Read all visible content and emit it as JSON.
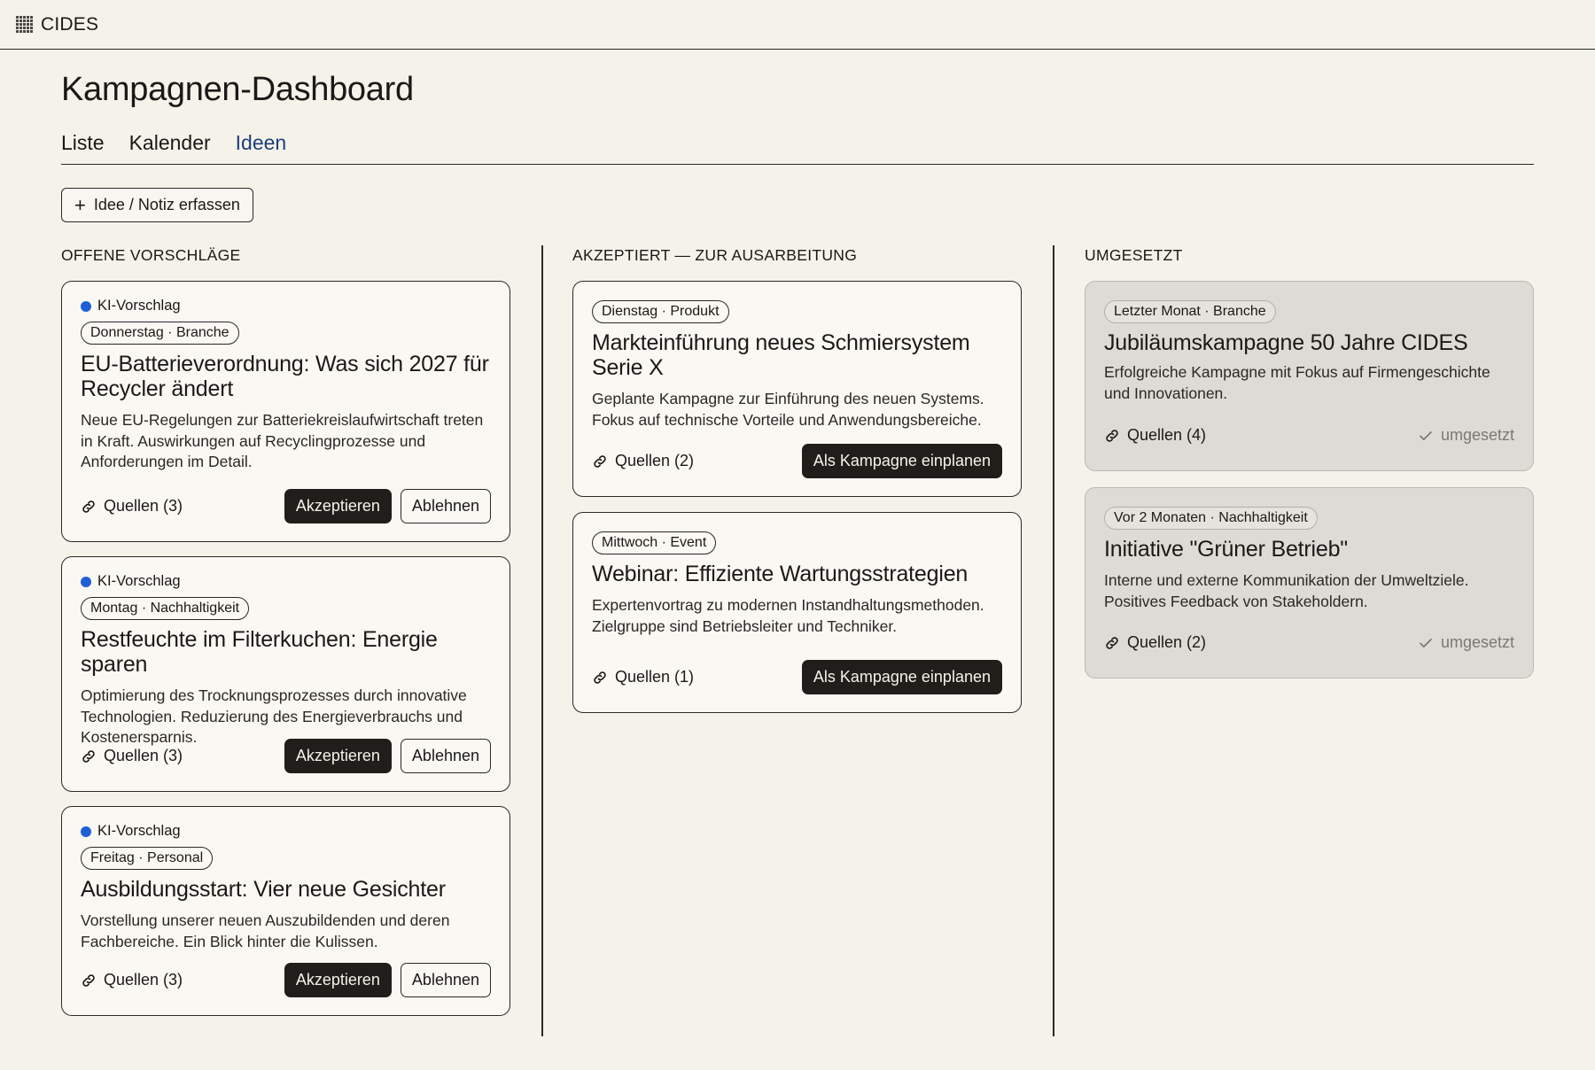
{
  "app": {
    "logo_text": "CIDES",
    "logo_icon": "grid-logo-icon"
  },
  "page": {
    "title": "Kampagnen-Dashboard"
  },
  "tabs": [
    {
      "label": "Liste",
      "active": false
    },
    {
      "label": "Kalender",
      "active": false
    },
    {
      "label": "Ideen",
      "active": true
    }
  ],
  "actions": {
    "add_label": "Idee / Notiz erfassen",
    "add_icon": "plus-icon"
  },
  "colors": {
    "accent_tab": "#1e3f7a",
    "ai_dot": "#1f5fd6",
    "dark_button": "#211d1a",
    "background": "#f5f2ea"
  },
  "columns": {
    "open": {
      "heading": "OFFENE VORSCHLÄGE",
      "cards": [
        {
          "badge": "KI-Vorschlag",
          "tag": "Donnerstag · Branche",
          "title": "EU-Batterieverordnung: Was sich 2027 für Recycler ändert",
          "description": "Neue EU-Regelungen zur Batteriekreislaufwirtschaft treten in Kraft. Auswirkungen auf Recyclingprozesse und Anforderungen im Detail.",
          "sources": "Quellen (3)",
          "accept": "Akzeptieren",
          "reject": "Ablehnen"
        },
        {
          "badge": "KI-Vorschlag",
          "tag": "Montag · Nachhaltigkeit",
          "title": "Restfeuchte im Filterkuchen: Energie sparen",
          "description": "Optimierung des Trocknungsprozesses durch innovative Technologien. Reduzierung des Energieverbrauchs und Kostenersparnis.",
          "sources": "Quellen (3)",
          "accept": "Akzeptieren",
          "reject": "Ablehnen"
        },
        {
          "badge": "KI-Vorschlag",
          "tag": "Freitag · Personal",
          "title": "Ausbildungsstart: Vier neue Gesichter",
          "description": "Vorstellung unserer neuen Auszubildenden und deren Fachbereiche. Ein Blick hinter die Kulissen.",
          "sources": "Quellen (3)",
          "accept": "Akzeptieren",
          "reject": "Ablehnen"
        }
      ]
    },
    "accepted": {
      "heading": "AKZEPTIERT — ZUR AUSARBEITUNG",
      "cards": [
        {
          "tag": "Dienstag · Produkt",
          "title": "Markteinführung neues Schmiersystem Serie X",
          "description": "Geplante Kampagne zur Einführung des neuen Systems. Fokus auf technische Vorteile und Anwendungsbereiche.",
          "sources": "Quellen (2)",
          "plan": "Als Kampagne einplanen"
        },
        {
          "tag": "Mittwoch · Event",
          "title": "Webinar: Effiziente Wartungsstrategien",
          "description": "Expertenvortrag zu modernen Instandhaltungsmethoden. Zielgruppe sind Betriebsleiter und Techniker.",
          "sources": "Quellen (1)",
          "plan": "Als Kampagne einplanen"
        }
      ]
    },
    "done": {
      "heading": "UMGESETZT",
      "cards": [
        {
          "tag": "Letzter Monat · Branche",
          "title": "Jubiläumskampagne 50 Jahre CIDES",
          "description": "Erfolgreiche Kampagne mit Fokus auf Firmengeschichte und Innovationen.",
          "sources": "Quellen (4)",
          "status": "umgesetzt"
        },
        {
          "tag": "Vor 2 Monaten · Nachhaltigkeit",
          "title": "Initiative \"Grüner Betrieb\"",
          "description": "Interne und externe Kommunikation der Umweltziele. Positives Feedback von Stakeholdern.",
          "sources": "Quellen (2)",
          "status": "umgesetzt"
        }
      ]
    }
  }
}
